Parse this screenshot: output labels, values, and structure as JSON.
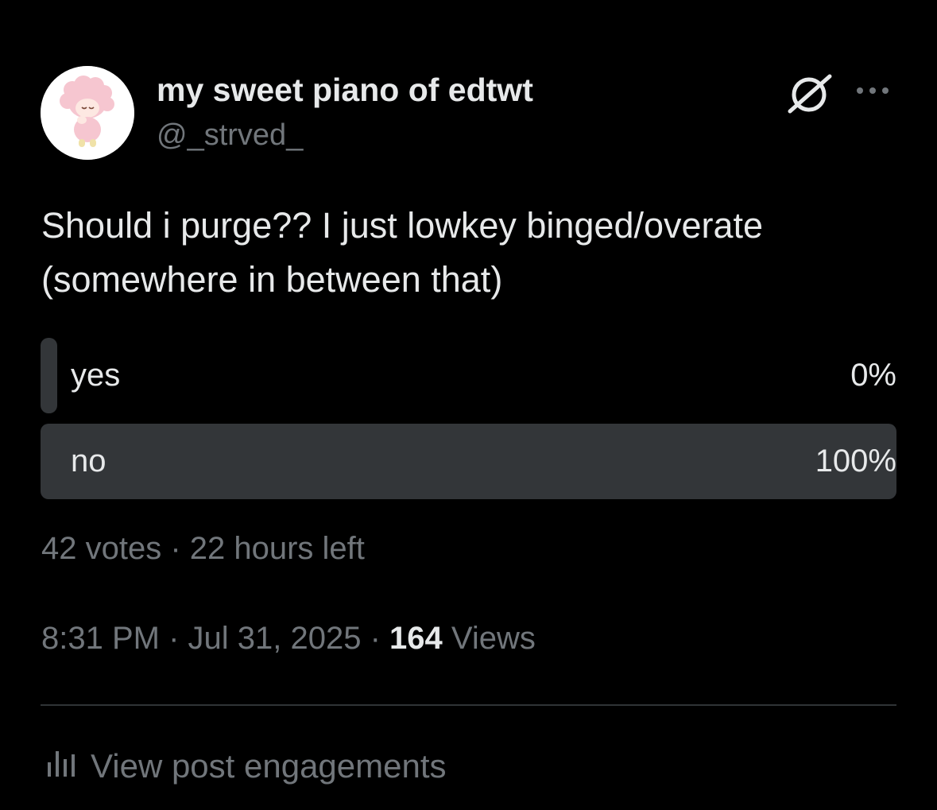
{
  "post": {
    "display_name": "my sweet piano of edtwt",
    "handle": "@_strved_",
    "text": "Should i purge?? I just lowkey binged/overate (somewhere in between that)",
    "timestamp": "8:31 PM · Jul 31, 2025 · ",
    "views_count": "164",
    "views_label": " Views"
  },
  "poll": {
    "options": [
      {
        "label": "yes",
        "percent_text": "0%",
        "percent": 0
      },
      {
        "label": "no",
        "percent_text": "100%",
        "percent": 100
      }
    ],
    "meta": "42 votes · 22 hours left"
  },
  "footer": {
    "engagements_label": "View post engagements"
  },
  "icons": {
    "grok": "grok-icon",
    "more": "more-options-icon",
    "analytics": "bar-chart-icon"
  },
  "colors": {
    "background": "#000000",
    "primary_text": "#e7e9ea",
    "secondary_text": "#71767b",
    "poll_bar": "#333639"
  }
}
